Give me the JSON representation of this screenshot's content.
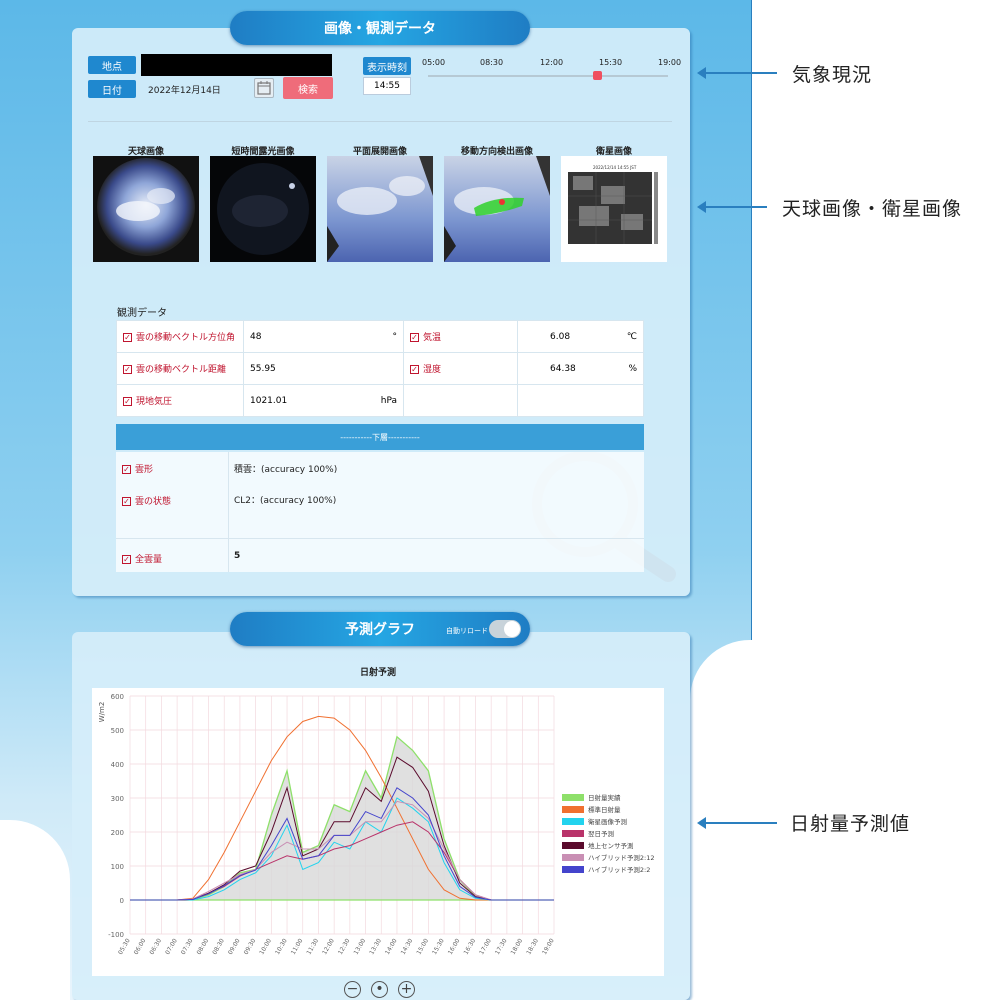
{
  "header": {
    "title": "画像・観測データ"
  },
  "query": {
    "location_label": "地点",
    "date_label": "日付",
    "date_value": "2022年12月14日",
    "search_button": "検索",
    "time_label": "表示時刻",
    "time_value": "14:55",
    "timeline_ticks": [
      "05:00",
      "08:30",
      "12:00",
      "15:30",
      "19:00"
    ],
    "timeline_value_fraction": 0.705
  },
  "images": {
    "titles": [
      "天球画像",
      "短時間露光画像",
      "平面展開画像",
      "移動方向検出画像",
      "衛星画像"
    ],
    "satellite_caption": "2022/12/14 14:55 JST"
  },
  "observation": {
    "title": "観測データ",
    "rows": [
      {
        "label": "雲の移動ベクトル方位角",
        "value": "48",
        "unit": "°"
      },
      {
        "label": "雲の移動ベクトル距離",
        "value": "55.95",
        "unit": ""
      },
      {
        "label": "現地気圧",
        "value": "1021.01",
        "unit": "hPa"
      }
    ],
    "rows_right": [
      {
        "label": "気温",
        "value": "6.08",
        "unit": "℃"
      },
      {
        "label": "湿度",
        "value": "64.38",
        "unit": "%"
      }
    ],
    "band": "-----------下層-----------",
    "cloud_rows": [
      {
        "label": "雲形",
        "value": "積雲：(accuracy 100%)"
      },
      {
        "label": "雲の状態",
        "value": "CL2：(accuracy 100%)"
      }
    ],
    "total": {
      "label": "全雲量",
      "value": "5"
    }
  },
  "forecast": {
    "title": "予測グラフ",
    "auto_reload_label": "自動リロード",
    "chart_title": "日射予測"
  },
  "annotations": [
    "気象現況",
    "天球画像・衛星画像",
    "日射量予測値"
  ],
  "chart_data": {
    "type": "line",
    "title": "日射予測",
    "ylabel": "W/m2",
    "ylim": [
      -100,
      600
    ],
    "yticks": [
      -100,
      0,
      100,
      200,
      300,
      400,
      500,
      600
    ],
    "x": [
      "05:30",
      "06:00",
      "06:30",
      "07:00",
      "07:30",
      "08:00",
      "08:30",
      "09:00",
      "09:30",
      "10:00",
      "10:30",
      "11:00",
      "11:30",
      "12:00",
      "12:30",
      "13:00",
      "13:30",
      "14:00",
      "14:30",
      "15:00",
      "15:30",
      "16:00",
      "16:30",
      "17:00",
      "17:30",
      "18:00",
      "18:30",
      "19:00"
    ],
    "xlim": [
      "05:30",
      "19:00"
    ],
    "grid": true,
    "legend_position": "right",
    "series": [
      {
        "name": "日射量実績",
        "color": "#8ee06a",
        "values": [
          0,
          0,
          0,
          0,
          2,
          15,
          40,
          80,
          90,
          250,
          380,
          140,
          160,
          280,
          260,
          380,
          300,
          480,
          440,
          380,
          180,
          60,
          10,
          0,
          0,
          0,
          0,
          0
        ]
      },
      {
        "name": "標準日射量",
        "color": "#f07030",
        "values": [
          0,
          0,
          0,
          0,
          5,
          60,
          140,
          230,
          320,
          410,
          480,
          525,
          540,
          535,
          500,
          440,
          360,
          270,
          180,
          90,
          30,
          5,
          0,
          0,
          0,
          0,
          0,
          0
        ]
      },
      {
        "name": "衛星画像予測",
        "color": "#22d3ee",
        "values": [
          0,
          0,
          0,
          0,
          0,
          10,
          30,
          60,
          80,
          130,
          220,
          90,
          110,
          170,
          150,
          230,
          200,
          300,
          270,
          230,
          110,
          30,
          5,
          0,
          0,
          0,
          0,
          0
        ]
      },
      {
        "name": "翌日予測",
        "color": "#b9336a",
        "values": [
          0,
          0,
          0,
          0,
          2,
          20,
          40,
          70,
          90,
          110,
          130,
          120,
          130,
          150,
          160,
          180,
          200,
          220,
          230,
          200,
          140,
          60,
          15,
          0,
          0,
          0,
          0,
          0
        ]
      },
      {
        "name": "地上センサ予測",
        "color": "#5a0a2c",
        "values": [
          0,
          0,
          0,
          0,
          2,
          20,
          45,
          85,
          100,
          200,
          330,
          130,
          150,
          230,
          230,
          330,
          290,
          420,
          390,
          320,
          160,
          50,
          10,
          0,
          0,
          0,
          0,
          0
        ]
      },
      {
        "name": "ハイブリッド予測2:12",
        "color": "#c98fb4",
        "values": [
          0,
          0,
          0,
          0,
          3,
          25,
          50,
          75,
          90,
          140,
          170,
          150,
          150,
          190,
          190,
          230,
          230,
          290,
          280,
          240,
          150,
          60,
          15,
          0,
          0,
          0,
          0,
          0
        ]
      },
      {
        "name": "ハイブリッド予測2:2",
        "color": "#4444cc",
        "values": [
          0,
          0,
          0,
          0,
          2,
          18,
          42,
          72,
          88,
          160,
          240,
          120,
          130,
          190,
          190,
          260,
          240,
          330,
          300,
          250,
          130,
          40,
          8,
          0,
          0,
          0,
          0,
          0
        ]
      }
    ]
  }
}
